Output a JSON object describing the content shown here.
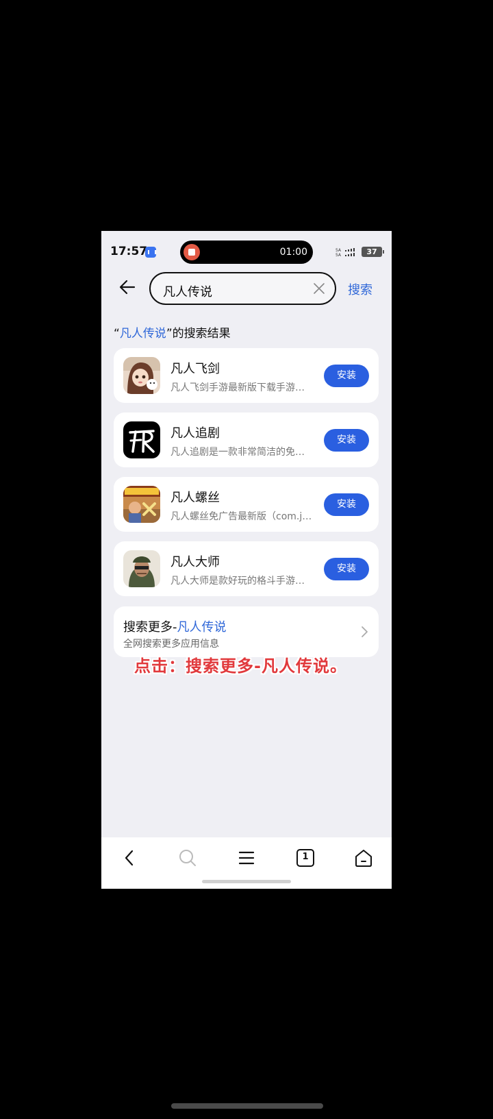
{
  "status_bar": {
    "time": "17:57",
    "timer": "01:00",
    "battery": "37"
  },
  "search": {
    "query": "凡人传说",
    "button_label": "搜索"
  },
  "results_header": {
    "prefix": "“",
    "keyword": "凡人传说",
    "suffix": "”的搜索结果"
  },
  "apps": [
    {
      "name": "凡人飞剑",
      "desc": "凡人飞剑手游最新版下载手游…",
      "install_label": "安装",
      "icon": "anime-girl-icon"
    },
    {
      "name": "凡人追剧",
      "desc": "凡人追剧是一款非常简洁的免…",
      "install_label": "安装",
      "icon": "fr-logo-icon"
    },
    {
      "name": "凡人螺丝",
      "desc": "凡人螺丝免广告最新版（com.j…",
      "install_label": "安装",
      "icon": "game-banner-icon"
    },
    {
      "name": "凡人大师",
      "desc": "凡人大师是款好玩的格斗手游…",
      "install_label": "安装",
      "icon": "soldier-portrait-icon"
    }
  ],
  "search_more": {
    "prefix": "搜索更多-",
    "keyword": "凡人传说",
    "subtitle": "全网搜索更多应用信息"
  },
  "annotation": "点击：搜索更多-凡人传说。",
  "bottom_nav": {
    "tab_count": "1"
  },
  "colors": {
    "accent": "#2a5fe0",
    "link": "#2f67d8",
    "annotation": "#e1393c",
    "background": "#efeff4"
  }
}
